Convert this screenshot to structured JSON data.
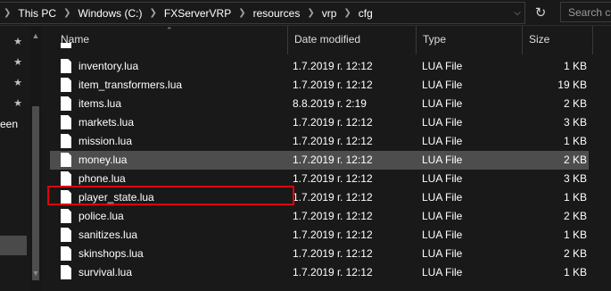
{
  "address_bar": {
    "breadcrumbs": [
      "This PC",
      "Windows (C:)",
      "FXServerVRP",
      "resources",
      "vrp",
      "cfg"
    ],
    "search_placeholder": "Search cf"
  },
  "nav_pane": {
    "partial_item_label": "een"
  },
  "columns": {
    "name": "Name",
    "date": "Date modified",
    "type": "Type",
    "size": "Size"
  },
  "files": [
    {
      "name": "inventory.lua",
      "date": "1.7.2019 г. 12:12",
      "type": "LUA File",
      "size": "1 KB"
    },
    {
      "name": "item_transformers.lua",
      "date": "1.7.2019 г. 12:12",
      "type": "LUA File",
      "size": "19 KB"
    },
    {
      "name": "items.lua",
      "date": "8.8.2019 г. 2:19",
      "type": "LUA File",
      "size": "2 KB"
    },
    {
      "name": "markets.lua",
      "date": "1.7.2019 г. 12:12",
      "type": "LUA File",
      "size": "3 KB"
    },
    {
      "name": "mission.lua",
      "date": "1.7.2019 г. 12:12",
      "type": "LUA File",
      "size": "1 KB"
    },
    {
      "name": "money.lua",
      "date": "1.7.2019 г. 12:12",
      "type": "LUA File",
      "size": "2 KB",
      "selected": true
    },
    {
      "name": "phone.lua",
      "date": "1.7.2019 г. 12:12",
      "type": "LUA File",
      "size": "3 KB"
    },
    {
      "name": "player_state.lua",
      "date": "1.7.2019 г. 12:12",
      "type": "LUA File",
      "size": "1 KB"
    },
    {
      "name": "police.lua",
      "date": "1.7.2019 г. 12:12",
      "type": "LUA File",
      "size": "2 KB"
    },
    {
      "name": "sanitizes.lua",
      "date": "1.7.2019 г. 12:12",
      "type": "LUA File",
      "size": "1 KB"
    },
    {
      "name": "skinshops.lua",
      "date": "1.7.2019 г. 12:12",
      "type": "LUA File",
      "size": "2 KB"
    },
    {
      "name": "survival.lua",
      "date": "1.7.2019 г. 12:12",
      "type": "LUA File",
      "size": "1 KB"
    }
  ],
  "highlighted_file": "player_state.lua",
  "colors": {
    "background": "#191919",
    "selected_row": "#4d4d4d",
    "highlight_border": "#e0000b"
  }
}
